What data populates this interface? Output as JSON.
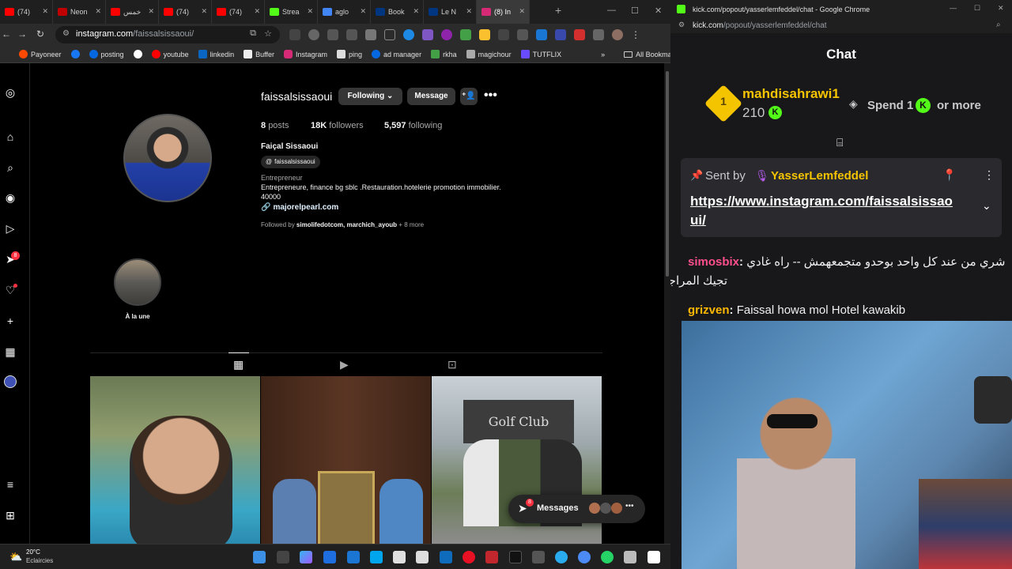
{
  "browser": {
    "tabs": [
      {
        "label": "(74)",
        "color": "#ff0000"
      },
      {
        "label": "Neon",
        "color": "#c00000"
      },
      {
        "label": "خمس",
        "color": "#ff0000"
      },
      {
        "label": "(74)",
        "color": "#ff0000"
      },
      {
        "label": "(74)",
        "color": "#ff0000"
      },
      {
        "label": "Strea",
        "color": "#53fc18"
      },
      {
        "label": "aglo",
        "color": "#4285f4"
      },
      {
        "label": "Book",
        "color": "#003580"
      },
      {
        "label": "Le N",
        "color": "#003580"
      },
      {
        "label": "(8) In",
        "color": "#d62976"
      }
    ],
    "url_host": "instagram.com",
    "url_path": "/faissalsissaoui/",
    "bookmarks": [
      "Payoneer",
      "",
      "posting",
      "",
      "youtube",
      "linkedin",
      "Buffer",
      "Instagram",
      "ping",
      "ad manager",
      "rkha",
      "magichour",
      "TUTFLIX"
    ],
    "all_bookmarks": "All Bookmarks"
  },
  "profile": {
    "username": "faissalsissaoui",
    "following_btn": "Following",
    "message_btn": "Message",
    "posts_count": "8",
    "posts_label": "posts",
    "followers_count": "18K",
    "followers_label": "followers",
    "following_count": "5,597",
    "following_label": "following",
    "full_name": "Faiçal Sissaoui",
    "threads_handle": "faissalsissaoui",
    "category": "Entrepreneur",
    "bio": "Entrepreneure, finance bg sblc .Restauration.hotelerie promotion immobilier.",
    "bio2": "40000",
    "link": "majorelpearl.com",
    "followed_by_prefix": "Followed by",
    "followed_by_names": "simolifedotcom, marchich_ayoub",
    "followed_by_more": "+ 8 more",
    "highlight_label": "À la une",
    "messages_label": "Messages",
    "messages_badge": "8",
    "notif_badge": "8"
  },
  "kick": {
    "window_title": "kick.com/popout/yasserlemfeddel/chat - Google Chrome",
    "url_host": "kick.com",
    "url_path": "/popout/yasserlemfeddel/chat",
    "chat_title": "Chat",
    "leader_name": "mahdisahrawi1",
    "leader_rank": "1",
    "leader_amount": "210",
    "spend_text": "Spend 1",
    "spend_suffix": "or more",
    "pinned_sent_by": "Sent by",
    "pinned_user": "YasserLemfeddel",
    "pinned_link_1": "https://www.instagram.com/faissalsissao",
    "pinned_link_2": "ui/",
    "msg1_user": "simosbix",
    "msg1_text": "شري من عند كل واحد بوحدو متجمعهمش -- راه غادي",
    "msg1_text2": "تجيك المراجعة من عند الضريبة",
    "msg2_user": "grizven",
    "msg2_text": "Faissal howa mol Hotel kawakib",
    "accent": "#53fc18",
    "user1_color": "#ff4f8b",
    "user2_color": "#ffb800"
  },
  "taskbar": {
    "temp": "20°C",
    "weather": "Eclaircies"
  }
}
